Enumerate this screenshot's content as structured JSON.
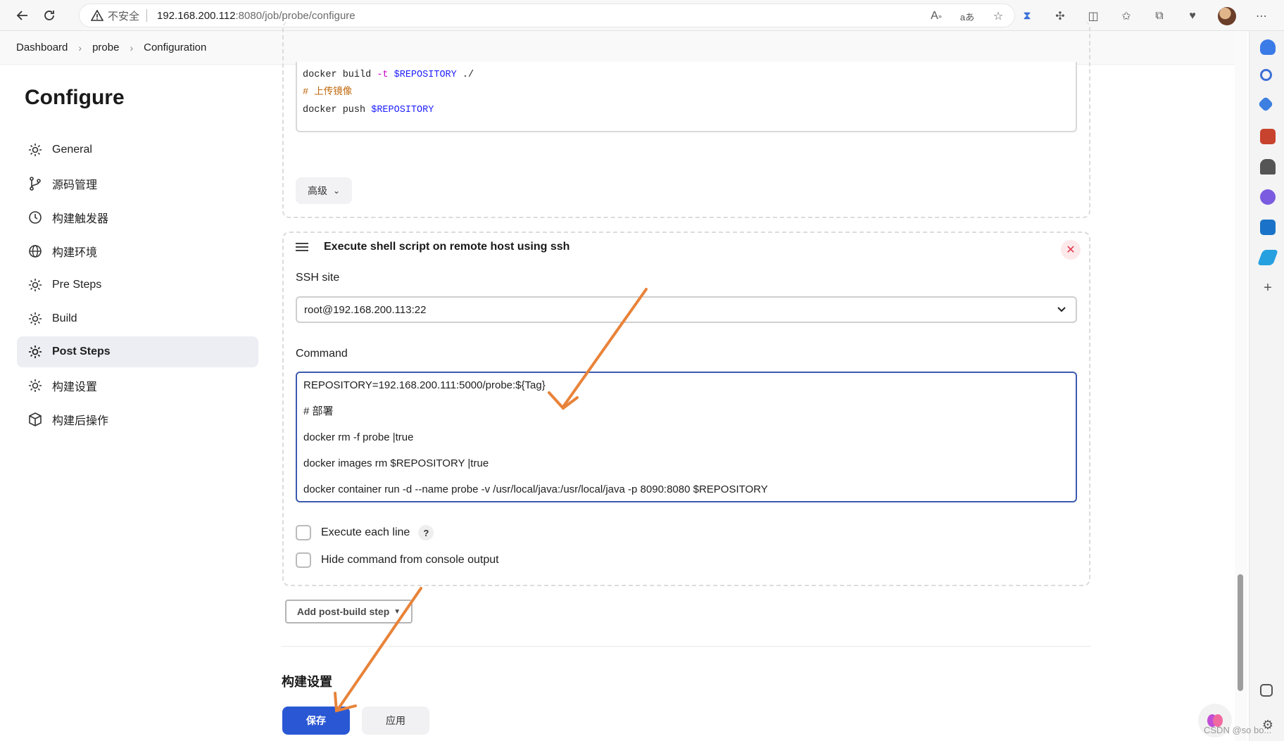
{
  "browser": {
    "insecure_label": "不安全",
    "url_host": "192.168.200.112",
    "url_path": ":8080/job/probe/configure"
  },
  "breadcrumb": [
    "Dashboard",
    "probe",
    "Configuration"
  ],
  "sidebar": {
    "title": "Configure",
    "items": [
      {
        "label": "General",
        "icon": "gear-icon",
        "active": false
      },
      {
        "label": "源码管理",
        "icon": "branch-icon",
        "active": false
      },
      {
        "label": "构建触发器",
        "icon": "clock-icon",
        "active": false
      },
      {
        "label": "构建环境",
        "icon": "globe-icon",
        "active": false
      },
      {
        "label": "Pre Steps",
        "icon": "gear-icon",
        "active": false
      },
      {
        "label": "Build",
        "icon": "gear-icon",
        "active": false
      },
      {
        "label": "Post Steps",
        "icon": "gear-icon",
        "active": true
      },
      {
        "label": "构建设置",
        "icon": "gear-icon",
        "active": false
      },
      {
        "label": "构建后操作",
        "icon": "cube-icon",
        "active": false
      }
    ]
  },
  "previous_step": {
    "code_lines": [
      {
        "cmd": "docker build ",
        "flag": "-t",
        "var": " $REPOSITORY",
        "rest": " ./"
      },
      {
        "comment": "# 上传镜像"
      },
      {
        "cmd": "docker push ",
        "var": "$REPOSITORY"
      }
    ],
    "advanced_label": "高级"
  },
  "ssh_step": {
    "title": "Execute shell script on remote host using ssh",
    "ssh_site_label": "SSH site",
    "ssh_site_value": "root@192.168.200.113:22",
    "command_label": "Command",
    "command_lines": [
      "REPOSITORY=192.168.200.111:5000/probe:${Tag}",
      "# 部署",
      "docker rm -f probe |true",
      "docker images rm $REPOSITORY |true",
      "docker container run -d --name probe -v /usr/local/java:/usr/local/java -p 8090:8080 $REPOSITORY"
    ],
    "execute_each_line_label": "Execute each line",
    "execute_each_line_checked": false,
    "hide_command_label": "Hide command from console output",
    "hide_command_checked": false,
    "help_label": "?"
  },
  "add_post_build_step_label": "Add post-build step",
  "section_title": "构建设置",
  "buttons": {
    "save": "保存",
    "apply": "应用"
  },
  "watermark": "CSDN @so bo...",
  "colors": {
    "primary": "#2a58d4",
    "arrow": "#e8833a",
    "danger": "#e0364b"
  }
}
